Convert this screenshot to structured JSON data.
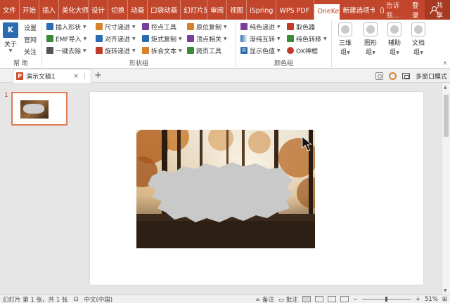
{
  "tabs": [
    {
      "label": "文件",
      "active": false
    },
    {
      "label": "开始",
      "active": false
    },
    {
      "label": "插入",
      "active": false
    },
    {
      "label": "美化大师",
      "active": false
    },
    {
      "label": "设计",
      "active": false
    },
    {
      "label": "切换",
      "active": false
    },
    {
      "label": "动画",
      "active": false
    },
    {
      "label": "口袋动画",
      "active": false
    },
    {
      "label": "幻灯片放映",
      "active": false
    },
    {
      "label": "审阅",
      "active": false
    },
    {
      "label": "视图",
      "active": false
    },
    {
      "label": "iSpring",
      "active": false
    },
    {
      "label": "WPS PDF",
      "active": false
    },
    {
      "label": "OneKey",
      "active": true
    },
    {
      "label": "新建选项卡",
      "active": false
    }
  ],
  "tell_me": "告诉我...",
  "login": "登录",
  "share": "共享",
  "ribbon": {
    "help_group": {
      "about": "关于",
      "settings": "设置",
      "website": "官网",
      "follow": "关注",
      "label": "帮 助"
    },
    "shape_group": {
      "insert_shape": "插入形状",
      "emf_import": "EMF导入",
      "one_key_remove": "一键去除",
      "size_step": "尺寸递进",
      "align_step": "对齐递进",
      "rotate_step": "旋转递进",
      "point_tool": "控点工具",
      "matrix_copy": "矩式复制",
      "split_text": "拆合文本",
      "original_copy": "原位复制",
      "vertex_related": "顶点相关",
      "cross_page_tool": "跨页工具",
      "label": "形状组"
    },
    "color_group": {
      "pure_step": "纯色递进",
      "gradient_swap": "渐纯互转",
      "show_color": "显示色值",
      "color_picker": "取色器",
      "pure_transfer": "纯色转移",
      "ok_frame": "OK神框",
      "label": "颜色组"
    },
    "big_buttons": [
      {
        "label": "三维",
        "sub": "组"
      },
      {
        "label": "图形",
        "sub": "组"
      },
      {
        "label": "辅助",
        "sub": "组"
      },
      {
        "label": "文档",
        "sub": "组"
      }
    ],
    "colors": {
      "red_icon": "#c0392b",
      "blue_icon": "#2b6cb0",
      "green_icon": "#3a8a3a",
      "orange_icon": "#d9822b",
      "purple_icon": "#7a3f9b"
    }
  },
  "document_tab": {
    "name": "演示文稿1",
    "close": "×",
    "menu": "⋮",
    "new_tab": "+",
    "multi_window": "多窗口模式"
  },
  "thumbnail": {
    "number": "1"
  },
  "status": {
    "slide": "幻灯片 第 1 张，共 1 张",
    "language": "中文(中国)",
    "notes": "备注",
    "comments": "批注",
    "zoom_minus": "−",
    "zoom_plus": "+",
    "zoom": "51%"
  },
  "accent": "#c1462b"
}
